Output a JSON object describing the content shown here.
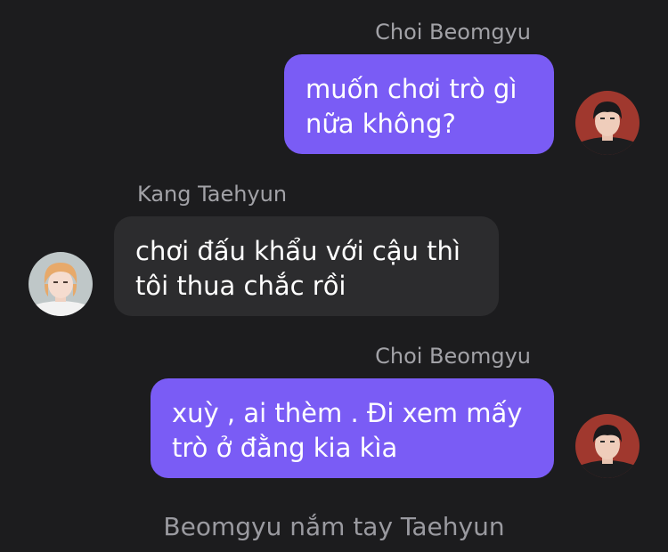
{
  "messages": [
    {
      "sender": "Choi Beomgyu",
      "text": "muốn chơi trò gì\nnữa không?",
      "direction": "outgoing",
      "avatar": "avatar-beomgyu"
    },
    {
      "sender": "Kang Taehyun",
      "text": "chơi đấu khẩu với cậu thì\ntôi thua chắc rồi",
      "direction": "incoming",
      "avatar": "avatar-taehyun"
    },
    {
      "sender": "Choi Beomgyu",
      "text": "xuỳ , ai thèm . Đi xem mấy\ntrò ở đằng kia kìa",
      "direction": "outgoing",
      "avatar": "avatar-beomgyu"
    }
  ],
  "system_message": "Beomgyu nắm tay Taehyun",
  "colors": {
    "background": "#1c1c1e",
    "outgoing_bubble": "#7a5cf5",
    "incoming_bubble": "#2c2c2e",
    "sender_name": "#a2a2a7",
    "system_text": "#9a9aa0"
  }
}
